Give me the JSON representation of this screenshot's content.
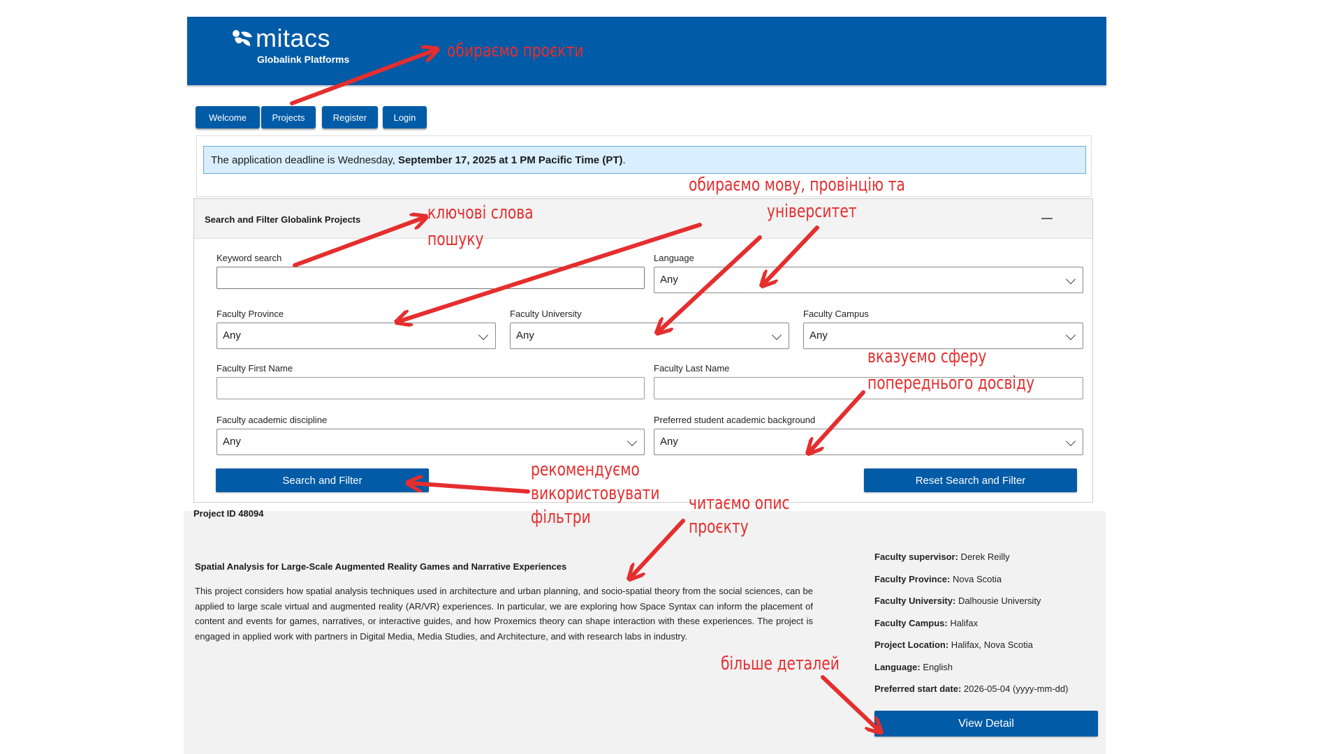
{
  "header": {
    "brand": "mitacs",
    "subtitle": "Globalink Platforms",
    "background": "#015ba6"
  },
  "nav": {
    "items": [
      {
        "label": "Welcome"
      },
      {
        "label": "Projects"
      },
      {
        "label": "Register"
      },
      {
        "label": "Login"
      }
    ]
  },
  "deadline": {
    "prefix": "The application deadline is Wednesday, ",
    "emphasis": "September 17, 2025 at 1 PM Pacific Time (PT)",
    "suffix": "."
  },
  "filter": {
    "title": "Search and Filter Globalink Projects",
    "keyword_label": "Keyword search",
    "keyword_value": "",
    "language_label": "Language",
    "language_value": "Any",
    "province_label": "Faculty Province",
    "province_value": "Any",
    "university_label": "Faculty University",
    "university_value": "Any",
    "campus_label": "Faculty Campus",
    "campus_value": "Any",
    "first_name_label": "Faculty First Name",
    "first_name_value": "",
    "last_name_label": "Faculty Last Name",
    "last_name_value": "",
    "discipline_label": "Faculty academic discipline",
    "discipline_value": "Any",
    "background_label": "Preferred student academic background",
    "background_value": "Any",
    "search_button": "Search and Filter",
    "reset_button": "Reset Search and Filter"
  },
  "project": {
    "id_label": "Project ID 48094",
    "title": "Spatial Analysis for Large-Scale Augmented Reality Games and Narrative Experiences",
    "description": "This project considers how spatial analysis techniques used in architecture and urban planning, and socio-spatial theory from the social sciences, can be applied to large scale virtual and augmented reality (AR/VR) experiences. In particular, we are exploring how Space Syntax can inform the placement of content and events for games, narratives, or interactive guides, and how Proxemics theory can shape interaction with these experiences. The project is engaged in applied work with partners in Digital Media, Media Studies, and Architecture, and with research labs in industry.",
    "meta": [
      {
        "key": "Faculty supervisor:",
        "value": " Derek Reilly"
      },
      {
        "key": "Faculty Province:",
        "value": " Nova Scotia"
      },
      {
        "key": "Faculty University:",
        "value": " Dalhousie University"
      },
      {
        "key": "Faculty Campus:",
        "value": " Halifax"
      },
      {
        "key": "Project Location:",
        "value": " Halifax, Nova Scotia"
      },
      {
        "key": "Language:",
        "value": " English"
      },
      {
        "key": "Preferred start date:",
        "value": " 2026-05-04 (yyyy-mm-dd)"
      }
    ],
    "view_button": "View Detail"
  },
  "annotations": {
    "projects": "обираємо проєкти",
    "keywords_1": "ключові слова",
    "keywords_2": "пошуку",
    "language_1": "обираємо мову, провінцію та",
    "language_2": "університет",
    "experience_1": "вказуємо сферу",
    "experience_2": "попереднього досвіду",
    "filters_1": "рекомендуємо",
    "filters_2": "використовувати",
    "filters_3": "фільтри",
    "read_1": "читаємо опис",
    "read_2": "проєкту",
    "details": "більше деталей",
    "color": "#e52e2e"
  }
}
